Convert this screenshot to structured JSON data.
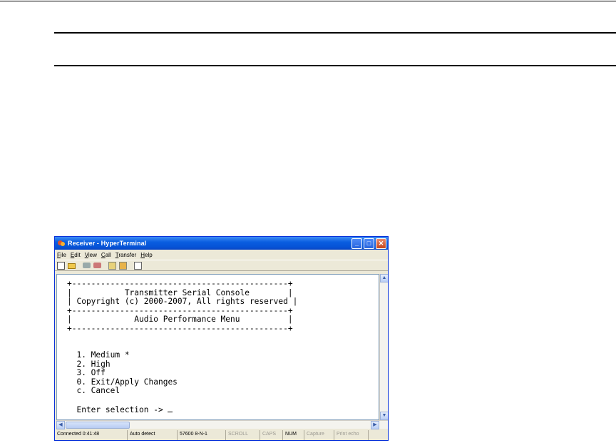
{
  "window": {
    "title": "Receiver - HyperTerminal",
    "buttons": {
      "minimize": "_",
      "maximize": "□",
      "close": "✕"
    }
  },
  "menu": [
    "File",
    "Edit",
    "View",
    "Call",
    "Transfer",
    "Help"
  ],
  "toolbar_icons": [
    "new-icon",
    "open-icon",
    "dial-icon",
    "disconnect-icon",
    "send-icon",
    "receive-icon",
    "properties-icon"
  ],
  "terminal": {
    "lines": [
      "+---------------------------------------------+",
      "|           Transmitter Serial Console        |",
      "| Copyright (c) 2000-2007, All rights reserved |",
      "+---------------------------------------------+",
      "|             Audio Performance Menu          |",
      "+---------------------------------------------+",
      "",
      "",
      "  1. Medium *",
      "  2. High",
      "  3. Off",
      "  0. Exit/Apply Changes",
      "  c. Cancel",
      "",
      "  Enter selection -> "
    ]
  },
  "status": {
    "connected": "Connected 0:41:48",
    "detect": "Auto detect",
    "settings": "57600 8-N-1",
    "scroll": "SCROLL",
    "caps": "CAPS",
    "num": "NUM",
    "capture": "Capture",
    "print_echo": "Print echo"
  }
}
